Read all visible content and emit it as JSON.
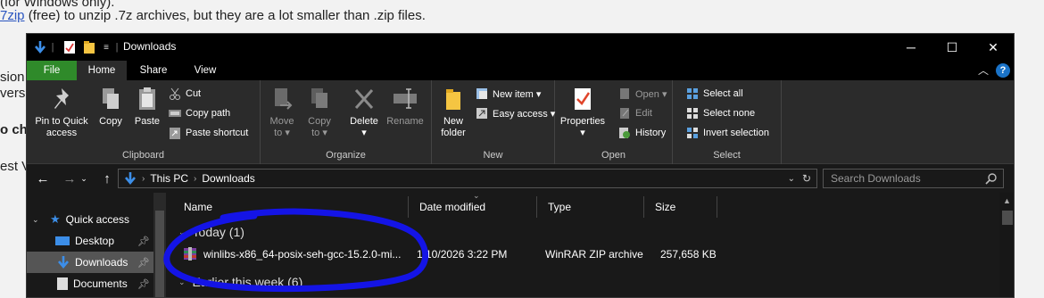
{
  "background_page": {
    "line1": "(for Windows only).",
    "line2_link": "7zip",
    "line2_text": " (free) to unzip .7z archives, but they are a lot smaller than .zip files.",
    "side1": "sion",
    "side2": "vers",
    "side3": "o ch",
    "side4": "est V"
  },
  "window": {
    "title": "Downloads",
    "buttons": {
      "minimize": "─",
      "maximize": "☐",
      "close": "✕"
    }
  },
  "tabs": [
    "File",
    "Home",
    "Share",
    "View"
  ],
  "ribbon": {
    "clipboard": {
      "label": "Clipboard",
      "pin_quick_access": [
        "Pin to Quick",
        "access"
      ],
      "copy": "Copy",
      "paste": "Paste",
      "cut": "Cut",
      "copy_path": "Copy path",
      "paste_shortcut": "Paste shortcut"
    },
    "organize": {
      "label": "Organize",
      "move_to": [
        "Move",
        "to ▾"
      ],
      "copy_to": [
        "Copy",
        "to ▾"
      ],
      "delete": [
        "Delete",
        "▾"
      ],
      "rename": "Rename"
    },
    "new": {
      "label": "New",
      "new_folder": [
        "New",
        "folder"
      ],
      "new_item": "New item ▾",
      "easy_access": "Easy access ▾"
    },
    "open": {
      "label": "Open",
      "properties": [
        "Properties",
        "▾"
      ],
      "open": "Open ▾",
      "edit": "Edit",
      "history": "History"
    },
    "select": {
      "label": "Select",
      "select_all": "Select all",
      "select_none": "Select none",
      "invert_selection": "Invert selection"
    }
  },
  "address": {
    "parts": [
      "This PC",
      "Downloads"
    ],
    "search_placeholder": "Search Downloads"
  },
  "nav": {
    "items": [
      {
        "label": "Quick access"
      },
      {
        "label": "Desktop"
      },
      {
        "label": "Downloads"
      },
      {
        "label": "Documents"
      }
    ]
  },
  "files": {
    "columns": [
      "Name",
      "Date modified",
      "Type",
      "Size"
    ],
    "groups": [
      {
        "label": "Today (1)",
        "rows": [
          {
            "name": "winlibs-x86_64-posix-seh-gcc-15.2.0-mi...",
            "date": "1/10/2026 3:22 PM",
            "type": "WinRAR ZIP archive",
            "size": "257,658 KB"
          }
        ]
      },
      {
        "label": "Earlier this week (6)",
        "rows": []
      }
    ]
  },
  "colors": {
    "file_tab": "#2f8a2a",
    "accent_blue": "#1a73c8",
    "annotation": "#1414e6"
  }
}
